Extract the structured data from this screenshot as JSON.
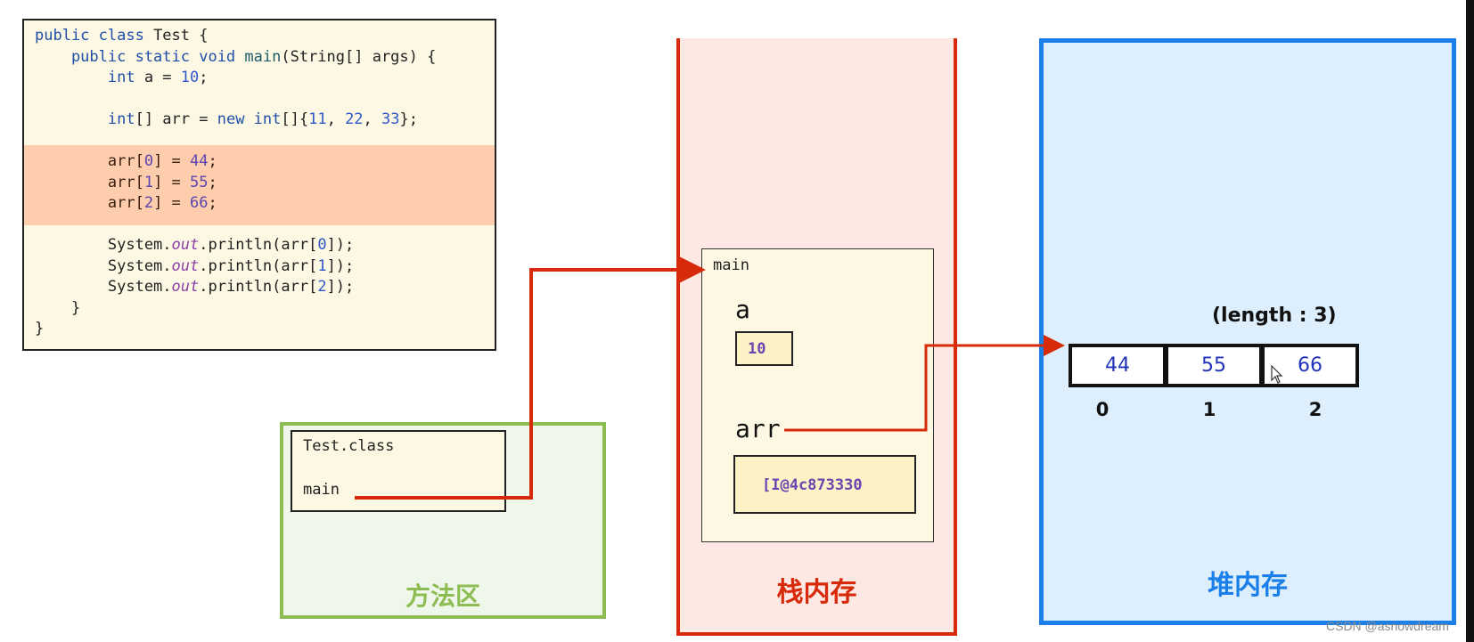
{
  "code": {
    "lines": [
      [
        {
          "t": "public class ",
          "c": "kw"
        },
        {
          "t": "Test {",
          "c": ""
        }
      ],
      [
        {
          "t": "    public static void ",
          "c": "kw"
        },
        {
          "t": "main",
          "c": "fn"
        },
        {
          "t": "(String[] args) {",
          "c": ""
        }
      ],
      [
        {
          "t": "        int ",
          "c": "kw"
        },
        {
          "t": "a = ",
          "c": ""
        },
        {
          "t": "10",
          "c": "num"
        },
        {
          "t": ";",
          "c": ""
        }
      ],
      [
        {
          "t": "",
          "c": ""
        }
      ],
      [
        {
          "t": "        int",
          "c": "kw"
        },
        {
          "t": "[] arr = ",
          "c": ""
        },
        {
          "t": "new int",
          "c": "kw"
        },
        {
          "t": "[]{",
          "c": ""
        },
        {
          "t": "11",
          "c": "num"
        },
        {
          "t": ", ",
          "c": ""
        },
        {
          "t": "22",
          "c": "num"
        },
        {
          "t": ", ",
          "c": ""
        },
        {
          "t": "33",
          "c": "num"
        },
        {
          "t": "};",
          "c": ""
        }
      ],
      [
        {
          "t": "",
          "c": ""
        }
      ],
      [
        {
          "t": "        arr[",
          "c": "plain"
        },
        {
          "t": "0",
          "c": "num2"
        },
        {
          "t": "] = ",
          "c": "plain"
        },
        {
          "t": "44",
          "c": "num2"
        },
        {
          "t": ";",
          "c": "plain"
        }
      ],
      [
        {
          "t": "        arr[",
          "c": "plain"
        },
        {
          "t": "1",
          "c": "num2"
        },
        {
          "t": "] = ",
          "c": "plain"
        },
        {
          "t": "55",
          "c": "num2"
        },
        {
          "t": ";",
          "c": "plain"
        }
      ],
      [
        {
          "t": "        arr[",
          "c": "plain"
        },
        {
          "t": "2",
          "c": "num2"
        },
        {
          "t": "] = ",
          "c": "plain"
        },
        {
          "t": "66",
          "c": "num2"
        },
        {
          "t": ";",
          "c": "plain"
        }
      ],
      [
        {
          "t": "",
          "c": ""
        }
      ],
      [
        {
          "t": "        System.",
          "c": ""
        },
        {
          "t": "out",
          "c": "it"
        },
        {
          "t": ".println(arr[",
          "c": ""
        },
        {
          "t": "0",
          "c": "num"
        },
        {
          "t": "]);",
          "c": ""
        }
      ],
      [
        {
          "t": "        System.",
          "c": ""
        },
        {
          "t": "out",
          "c": "it"
        },
        {
          "t": ".println(arr[",
          "c": ""
        },
        {
          "t": "1",
          "c": "num"
        },
        {
          "t": "]);",
          "c": ""
        }
      ],
      [
        {
          "t": "        System.",
          "c": ""
        },
        {
          "t": "out",
          "c": "it"
        },
        {
          "t": ".println(arr[",
          "c": ""
        },
        {
          "t": "2",
          "c": "num"
        },
        {
          "t": "]);",
          "c": ""
        }
      ],
      [
        {
          "t": "    }",
          "c": ""
        }
      ],
      [
        {
          "t": "}",
          "c": ""
        }
      ]
    ],
    "highlighted_lines": [
      6,
      7,
      8
    ]
  },
  "method_area": {
    "title": "方法区",
    "class_name": "Test.class",
    "method": "main"
  },
  "stack": {
    "title": "栈内存",
    "frame_name": "main",
    "var_a_name": "a",
    "var_a_value": "10",
    "var_arr_name": "arr",
    "var_arr_value": "[I@4c873330"
  },
  "heap": {
    "title": "堆内存",
    "length_label": "(length : 3)",
    "cells": [
      "44",
      "55",
      "66"
    ],
    "indices": [
      "0",
      "1",
      "2"
    ]
  },
  "watermark": "CSDN @asnowdream",
  "colors": {
    "method_area": "#8dbd52",
    "stack": "#d72a0a",
    "heap": "#1a7fe8",
    "arrow": "#d72a0a",
    "highlight": "#fdcdad"
  }
}
